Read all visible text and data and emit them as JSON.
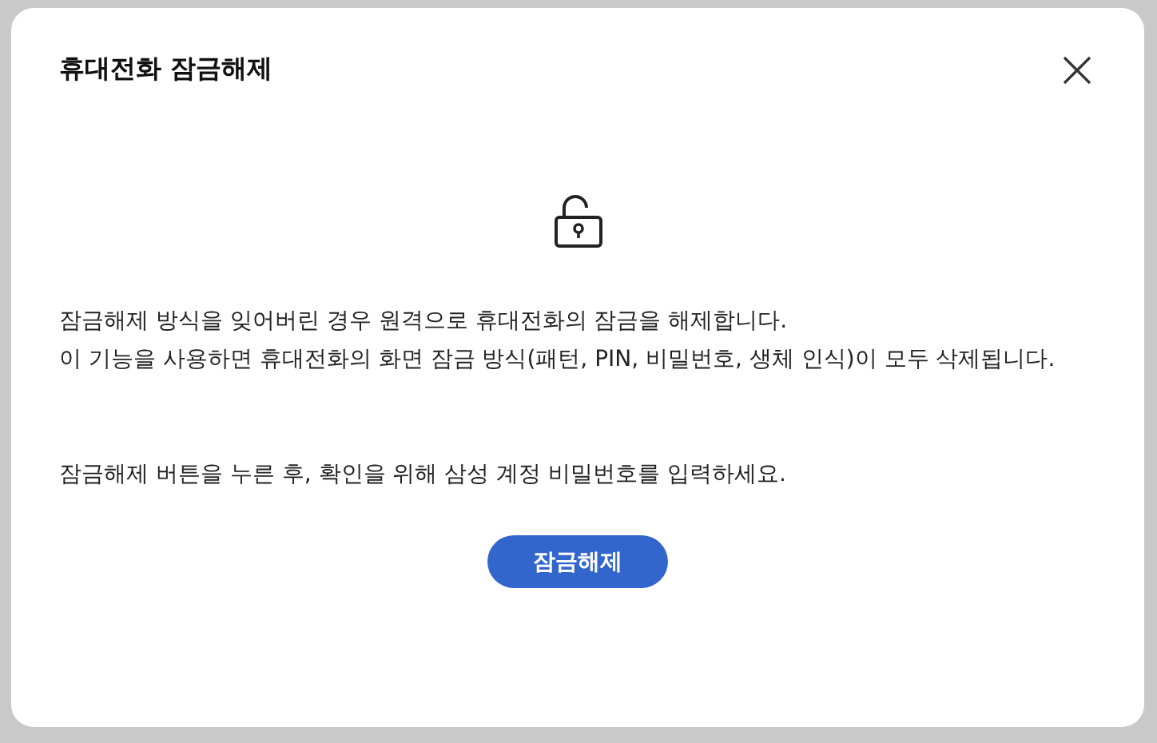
{
  "dialog": {
    "title": "휴대전화 잠금해제",
    "paragraphs": [
      [
        "잠금해제 방식을 잊어버린 경우 원격으로 휴대전화의 잠금을 해제합니다.",
        "이 기능을 사용하면 휴대전화의 화면 잠금 방식(패턴, PIN, 비밀번호, 생체 인식)이 모두 삭제됩니다."
      ],
      [
        "잠금해제 버튼을 누른 후, 확인을 위해 삼성 계정 비밀번호를 입력하세요."
      ]
    ],
    "button": "잠금해제"
  }
}
